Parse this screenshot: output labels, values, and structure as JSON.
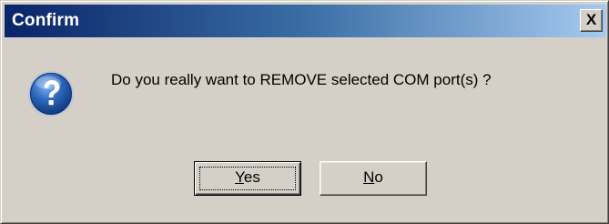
{
  "window": {
    "title": "Confirm",
    "close_glyph": "X"
  },
  "message": {
    "text": "Do you really want to REMOVE selected COM port(s) ?",
    "icon": "question-icon"
  },
  "buttons": {
    "yes": {
      "accel": "Y",
      "rest": "es"
    },
    "no": {
      "accel": "N",
      "rest": "o"
    }
  },
  "colors": {
    "title_start": "#0a246a",
    "title_end": "#a6caf0",
    "face": "#d4d0c8",
    "icon_blue": "#2a64b8"
  }
}
